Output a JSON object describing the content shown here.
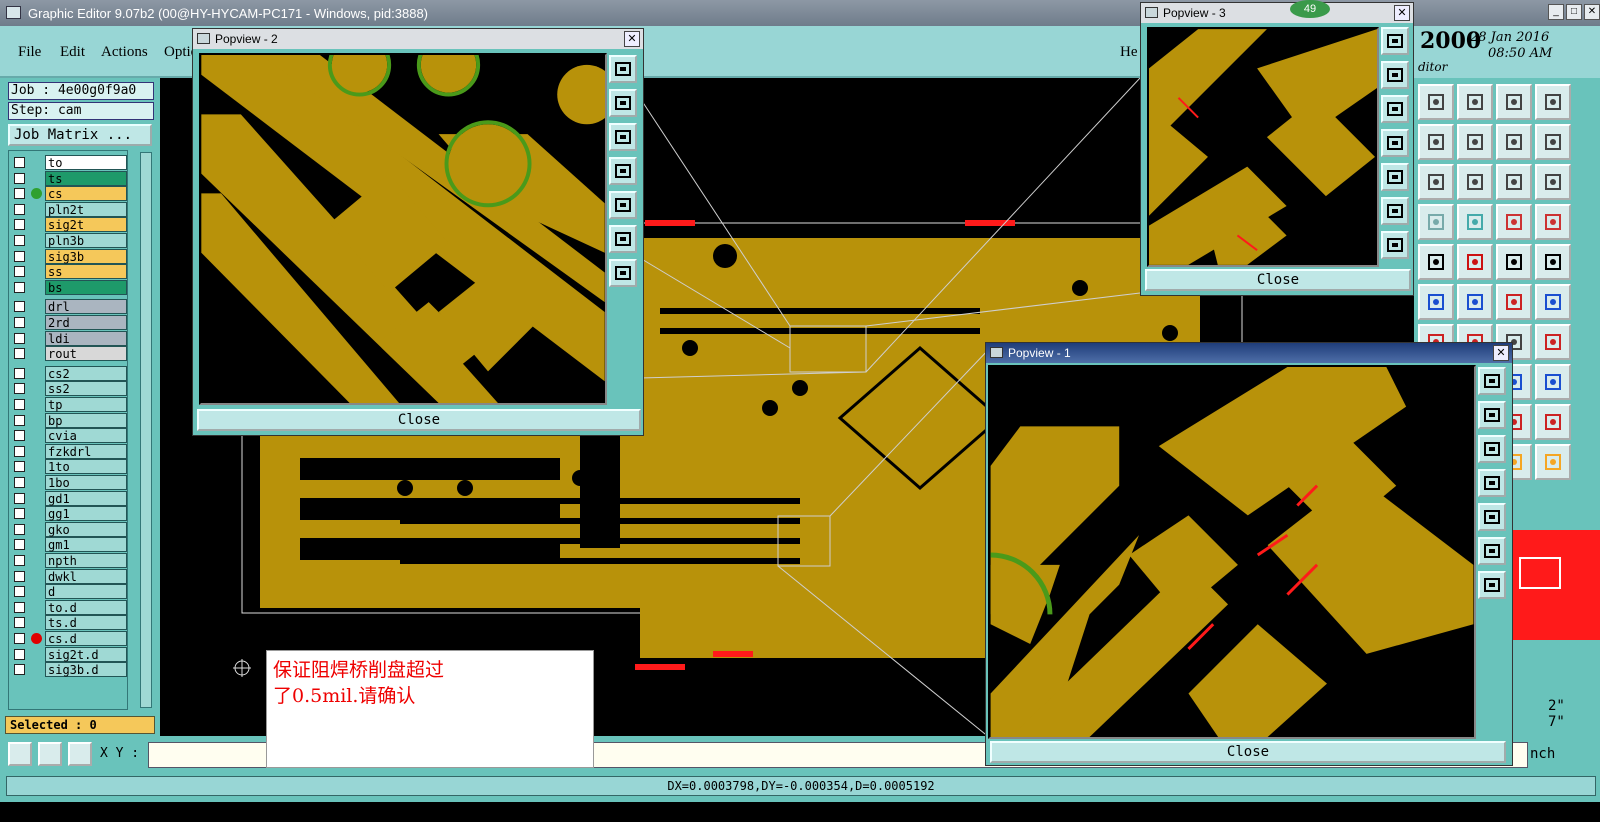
{
  "window": {
    "title": "Graphic Editor 9.07b2 (00@HY-HYCAM-PC171 - Windows, pid:3888)"
  },
  "menu": {
    "file": "File",
    "edit": "Edit",
    "actions": "Actions",
    "options": "Optio",
    "help": "He"
  },
  "job": {
    "label": "Job : 4e00g0f9a0",
    "step": "Step: cam",
    "matrix_button": "Job Matrix ..."
  },
  "layers": [
    {
      "name": "to",
      "color": "#ffffff",
      "dot": ""
    },
    {
      "name": "ts",
      "color": "#1e9a6a",
      "dot": ""
    },
    {
      "name": "cs",
      "color": "#f5c85a",
      "dot": "#2fa02f"
    },
    {
      "name": "pln2t",
      "color": "#9fd9d4",
      "dot": ""
    },
    {
      "name": "sig2t",
      "color": "#f5c85a",
      "dot": ""
    },
    {
      "name": "pln3b",
      "color": "#9fd9d4",
      "dot": ""
    },
    {
      "name": "sig3b",
      "color": "#f5c85a",
      "dot": ""
    },
    {
      "name": "ss",
      "color": "#f5c85a",
      "dot": ""
    },
    {
      "name": "bs",
      "color": "#1e9a6a",
      "dot": ""
    },
    {
      "name": "drl",
      "color": "#aab5c0",
      "dot": ""
    },
    {
      "name": "2rd",
      "color": "#aab5c0",
      "dot": ""
    },
    {
      "name": "ldi",
      "color": "#aab5c0",
      "dot": ""
    },
    {
      "name": "rout",
      "color": "#d8d8d8",
      "dot": ""
    },
    {
      "name": "cs2",
      "color": "#9fd9d4",
      "dot": ""
    },
    {
      "name": "ss2",
      "color": "#9fd9d4",
      "dot": ""
    },
    {
      "name": "tp",
      "color": "#9fd9d4",
      "dot": ""
    },
    {
      "name": "bp",
      "color": "#9fd9d4",
      "dot": ""
    },
    {
      "name": "cvia",
      "color": "#9fd9d4",
      "dot": ""
    },
    {
      "name": "fzkdrl",
      "color": "#9fd9d4",
      "dot": ""
    },
    {
      "name": "1to",
      "color": "#9fd9d4",
      "dot": ""
    },
    {
      "name": "1bo",
      "color": "#9fd9d4",
      "dot": ""
    },
    {
      "name": "gd1",
      "color": "#9fd9d4",
      "dot": ""
    },
    {
      "name": "gg1",
      "color": "#9fd9d4",
      "dot": ""
    },
    {
      "name": "gko",
      "color": "#9fd9d4",
      "dot": ""
    },
    {
      "name": "gm1",
      "color": "#9fd9d4",
      "dot": ""
    },
    {
      "name": "npth",
      "color": "#9fd9d4",
      "dot": ""
    },
    {
      "name": "dwkl",
      "color": "#9fd9d4",
      "dot": ""
    },
    {
      "name": "d",
      "color": "#9fd9d4",
      "dot": ""
    },
    {
      "name": "to.d",
      "color": "#9fd9d4",
      "dot": ""
    },
    {
      "name": "ts.d",
      "color": "#9fd9d4",
      "dot": ""
    },
    {
      "name": "cs.d",
      "color": "#9fd9d4",
      "dot": "#e00000"
    },
    {
      "name": "sig2t.d",
      "color": "#9fd9d4",
      "dot": ""
    },
    {
      "name": "sig3b.d",
      "color": "#9fd9d4",
      "dot": ""
    }
  ],
  "selected": "Selected : 0",
  "xy_label": "X Y :",
  "status": "DX=0.0003798,DY=-0.000354,D=0.0005192",
  "date": {
    "year": "2000",
    "date": "28 Jan 2016",
    "time": "08:50 AM",
    "sub": "ditor"
  },
  "popups": {
    "p1": {
      "title": "Popview - 1",
      "close": "Close"
    },
    "p2": {
      "title": "Popview - 2",
      "close": "Close"
    },
    "p3": {
      "title": "Popview - 3",
      "close": "Close"
    }
  },
  "badge": "49",
  "message": {
    "line1": "保证阻焊桥削盘超过",
    "line2": "了0.5mil.请确认"
  },
  "right_labels": {
    "a": "2\"",
    "b": "7\"",
    "c": "nch"
  },
  "colors": {
    "copper": "#b8920a",
    "mask": "#4a9a1a",
    "red": "#ff1a1a",
    "panel": "#69c3bb"
  }
}
